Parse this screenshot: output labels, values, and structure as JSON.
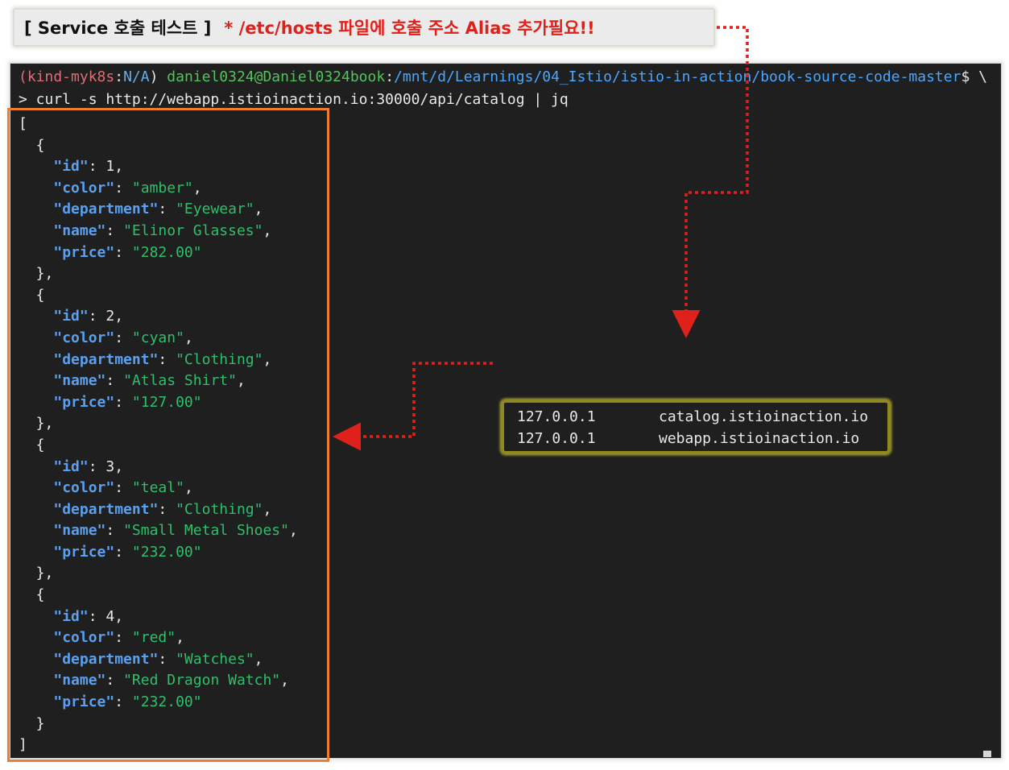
{
  "banner": {
    "title": "[ Service 호출 테스트 ]",
    "note": "* /etc/hosts 파일에 호출 주소 Alias 추가필요!!"
  },
  "terminal": {
    "prompt": {
      "env": "(kind-myk8s",
      "colon": ":",
      "ns": "N/A",
      "close": ")",
      "user": "daniel0324@Daniel0324book",
      "path_sep": ":",
      "path": "/mnt/d/Learnings/04_Istio/istio-in-action/book-source-code-master",
      "suffix": "$ \\"
    },
    "command": "> curl -s http://webapp.istioinaction.io:30000/api/catalog | jq",
    "catalog": [
      {
        "id": "1",
        "color": "amber",
        "department": "Eyewear",
        "name": "Elinor Glasses",
        "price": "282.00"
      },
      {
        "id": "2",
        "color": "cyan",
        "department": "Clothing",
        "name": "Atlas Shirt",
        "price": "127.00"
      },
      {
        "id": "3",
        "color": "teal",
        "department": "Clothing",
        "name": "Small Metal Shoes",
        "price": "232.00"
      },
      {
        "id": "4",
        "color": "red",
        "department": "Watches",
        "name": "Red Dragon Watch",
        "price": "232.00"
      }
    ]
  },
  "hosts": [
    {
      "ip": "127.0.0.1",
      "host": "catalog.istioinaction.io"
    },
    {
      "ip": "127.0.0.1",
      "host": "webapp.istioinaction.io"
    }
  ],
  "colors": {
    "terminal_bg": "#1f1f1f",
    "json_key": "#5aa0f0",
    "json_string": "#2fbf6a",
    "highlight_orange": "#ed7d31",
    "highlight_olive": "#8e8a1f",
    "arrow_red": "#e0201a"
  }
}
